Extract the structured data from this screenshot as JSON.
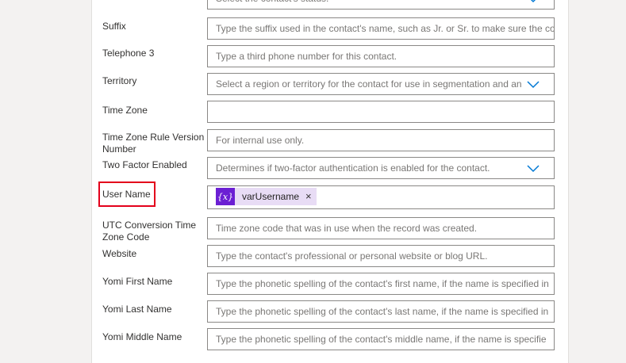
{
  "fields": [
    {
      "label": "",
      "placeholder": "Select the contact's status.",
      "type": "dropdown"
    },
    {
      "label": "Suffix",
      "placeholder": "Type the suffix used in the contact's name, such as Jr. or Sr. to make sure the co",
      "type": "text"
    },
    {
      "label": "Telephone 3",
      "placeholder": "Type a third phone number for this contact.",
      "type": "text"
    },
    {
      "label": "Territory",
      "placeholder": "Select a region or territory for the contact for use in segmentation and an",
      "type": "dropdown"
    },
    {
      "label": "Time Zone",
      "placeholder": "",
      "type": "text"
    },
    {
      "label": "Time Zone Rule Version Number",
      "placeholder": "For internal use only.",
      "type": "text"
    },
    {
      "label": "Two Factor Enabled",
      "placeholder": "Determines if two-factor authentication is enabled for the contact.",
      "type": "dropdown"
    },
    {
      "label": "User Name",
      "placeholder": "",
      "type": "token",
      "token": {
        "icon": "{x}",
        "value": "varUsername",
        "close": "×"
      }
    },
    {
      "label": "UTC Conversion Time Zone Code",
      "placeholder": "Time zone code that was in use when the record was created.",
      "type": "text"
    },
    {
      "label": "Website",
      "placeholder": "Type the contact's professional or personal website or blog URL.",
      "type": "text"
    },
    {
      "label": "Yomi First Name",
      "placeholder": "Type the phonetic spelling of the contact's first name, if the name is specified in",
      "type": "text"
    },
    {
      "label": "Yomi Last Name",
      "placeholder": "Type the phonetic spelling of the contact's last name, if the name is specified in",
      "type": "text"
    },
    {
      "label": "Yomi Middle Name",
      "placeholder": "Type the phonetic spelling of the contact's middle name, if the name is specifie",
      "type": "text"
    }
  ],
  "colors": {
    "highlight": "#e3001b",
    "token_icon": "#6b1fd3",
    "token_bg": "#e8dcf5",
    "chevron": "#0078d4"
  }
}
